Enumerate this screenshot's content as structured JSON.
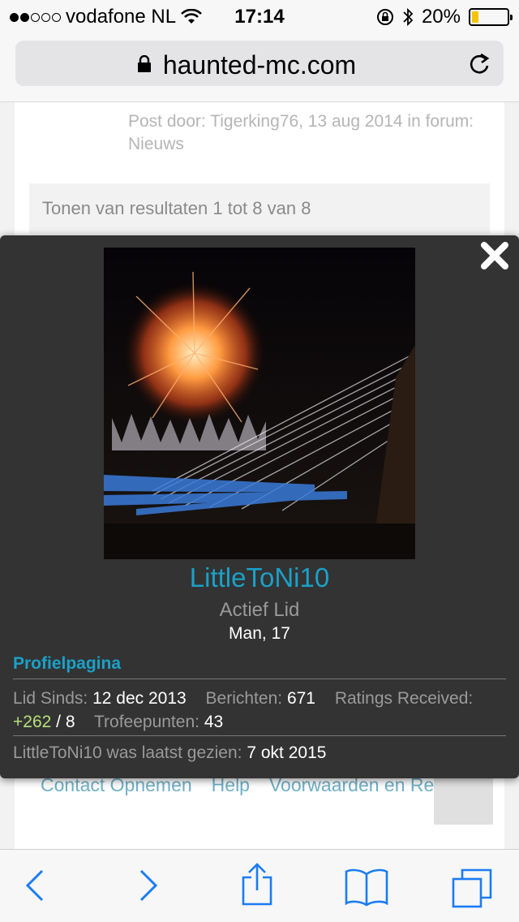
{
  "status_bar": {
    "carrier": "vodafone NL",
    "time": "17:14",
    "battery_percent": "20%",
    "battery_level": 0.2,
    "signal_bars": 2,
    "icons": [
      "wifi-icon",
      "rotation-lock-icon",
      "bluetooth-icon",
      "battery-icon"
    ]
  },
  "browser": {
    "url": "haunted-mc.com",
    "icons": [
      "lock-icon",
      "reload-icon"
    ]
  },
  "page": {
    "post_meta": "Post door: Tigerking76, 13 aug 2014 in forum: Nieuws",
    "results_text": "Tonen van resultaten 1 tot 8 van 8",
    "footer_links": [
      "Contact Opnemen",
      "Help",
      "Voorwaarden en Regels"
    ]
  },
  "profile_card": {
    "username": "LittleToNi10",
    "rank": "Actief Lid",
    "info": "Man, 17",
    "profile_link": "Profielpagina",
    "stats": {
      "member_since_label": "Lid Sinds:",
      "member_since_value": "12 dec 2013",
      "messages_label": "Berichten:",
      "messages_value": "671",
      "ratings_label": "Ratings Received:",
      "ratings_positive": "+262",
      "ratings_rest": "/ 8",
      "trophy_label": "Trofeepunten:",
      "trophy_value": "43"
    },
    "last_seen_label": "LittleToNi10 was laatst gezien:",
    "last_seen_value": "7 okt 2015"
  },
  "toolbar": {
    "icons": [
      "back-icon",
      "forward-icon",
      "share-icon",
      "bookmarks-icon",
      "tabs-icon"
    ]
  },
  "colors": {
    "accent": "#1aa1c8",
    "positive": "#b6e07a",
    "overlay_bg": "#333333"
  }
}
